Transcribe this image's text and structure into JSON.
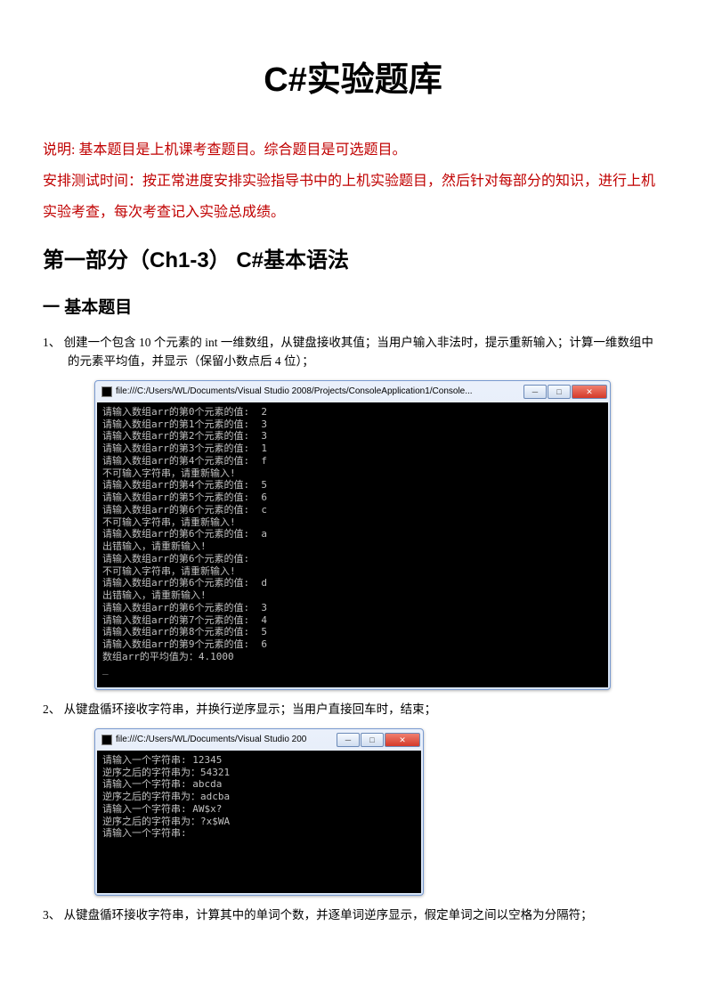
{
  "title": "C#实验题库",
  "note_line1": "说明: 基本题目是上机课考查题目。综合题目是可选题目。",
  "note_line2": "安排测试时间：按正常进度安排实验指导书中的上机实验题目，然后针对每部分的知识，进行上机实验考查，每次考查记入实验总成绩。",
  "section1_heading": "第一部分（Ch1-3）  C#基本语法",
  "sub_heading": "一 基本题目",
  "q1": "1、 创建一个包含 10 个元素的 int 一维数组，从键盘接收其值；当用户输入非法时，提示重新输入；计算一维数组中的元素平均值，并显示（保留小数点后 4 位）；",
  "q2": "2、 从键盘循环接收字符串，并换行逆序显示；当用户直接回车时，结束；",
  "q3": "3、 从键盘循环接收字符串，计算其中的单词个数，并逐单词逆序显示，假定单词之间以空格为分隔符；",
  "console1": {
    "title": "file:///C:/Users/WL/Documents/Visual Studio 2008/Projects/ConsoleApplication1/Console...",
    "body": "请输入数组arr的第0个元素的值:  2\n请输入数组arr的第1个元素的值:  3\n请输入数组arr的第2个元素的值:  3\n请输入数组arr的第3个元素的值:  1\n请输入数组arr的第4个元素的值:  f\n不可输入字符串，请重新输入!\n请输入数组arr的第4个元素的值:  5\n请输入数组arr的第5个元素的值:  6\n请输入数组arr的第6个元素的值:  c\n不可输入字符串，请重新输入!\n请输入数组arr的第6个元素的值:  a\n出错输入，请重新输入!\n请输入数组arr的第6个元素的值:  \n不可输入字符串，请重新输入!\n请输入数组arr的第6个元素的值:  d\n出错输入，请重新输入!\n请输入数组arr的第6个元素的值:  3\n请输入数组arr的第7个元素的值:  4\n请输入数组arr的第8个元素的值:  5\n请输入数组arr的第9个元素的值:  6\n数组arr的平均值为：4.1000\n_"
  },
  "console2": {
    "title": "file:///C:/Users/WL/Documents/Visual Studio 200",
    "body": "请输入一个字符串: 12345\n逆序之后的字符串为：54321\n请输入一个字符串: abcda\n逆序之后的字符串为：adcba\n请输入一个字符串: AW$x?\n逆序之后的字符串为：?x$WA\n请输入一个字符串: \n"
  },
  "window_buttons": {
    "minimize": "─",
    "maximize": "□",
    "close": "✕"
  }
}
